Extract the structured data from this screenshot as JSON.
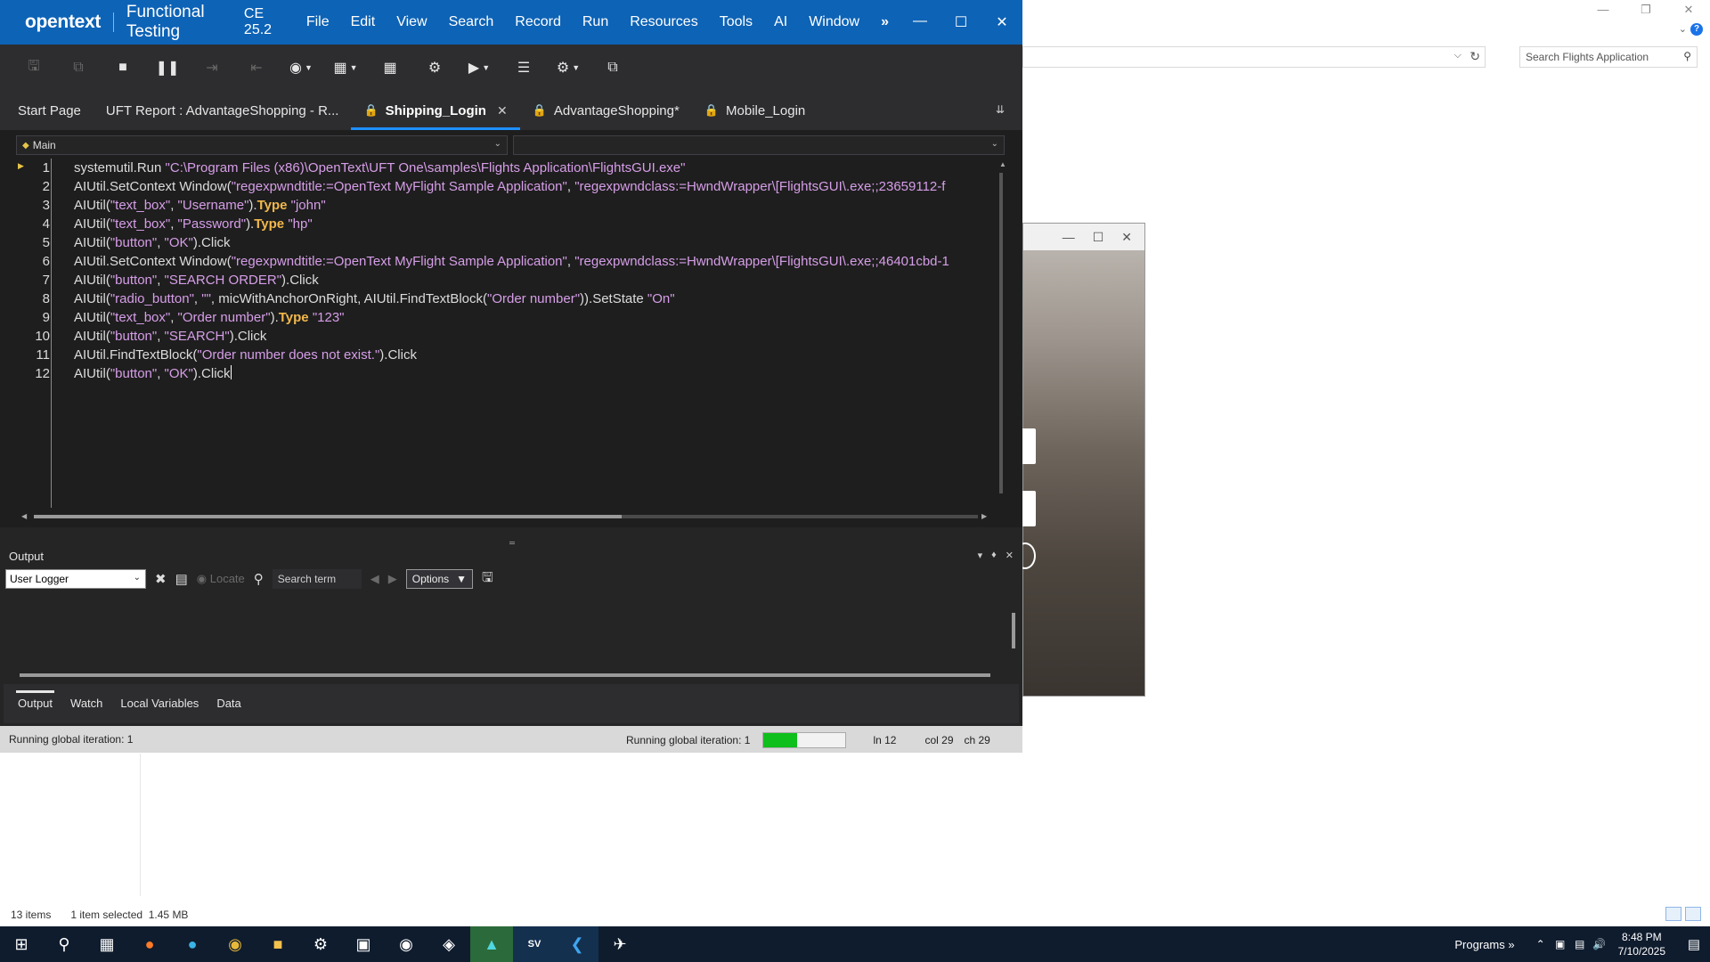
{
  "background": {
    "search_placeholder": "Search Flights Application",
    "status_items": "13 items",
    "status_selected": "1 item selected",
    "status_size": "1.45 MB"
  },
  "titlebar": {
    "logo": "opentext",
    "app_name": "Functional Testing",
    "version": "CE 25.2",
    "menu": [
      "File",
      "Edit",
      "View",
      "Search",
      "Record",
      "Run",
      "Resources",
      "Tools",
      "AI",
      "Window"
    ],
    "more": "»"
  },
  "tabs": [
    {
      "label": "Start Page"
    },
    {
      "label": "UFT Report : AdvantageShopping - R..."
    },
    {
      "label": "Shipping_Login"
    },
    {
      "label": "AdvantageShopping*"
    },
    {
      "label": "Mobile_Login"
    }
  ],
  "editor": {
    "combo_left": "Main",
    "combo_right": "",
    "line_numbers": [
      "1",
      "2",
      "3",
      "4",
      "5",
      "6",
      "7",
      "8",
      "9",
      "10",
      "11",
      "12"
    ]
  },
  "output": {
    "title": "Output",
    "logger": "User Logger",
    "locate": "Locate",
    "search_placeholder": "Search term",
    "options": "Options"
  },
  "bottom_tabs": [
    "Output",
    "Watch",
    "Local Variables",
    "Data"
  ],
  "statusbar": {
    "left": "Running global iteration: 1",
    "right": "Running global iteration: 1",
    "progress_fraction": 0.41,
    "line": "ln 12",
    "col": "col 29",
    "ch": "ch 29"
  },
  "taskbar": {
    "programs": "Programs",
    "chevron": "»",
    "time": "8:48 PM",
    "date": "7/10/2025"
  }
}
